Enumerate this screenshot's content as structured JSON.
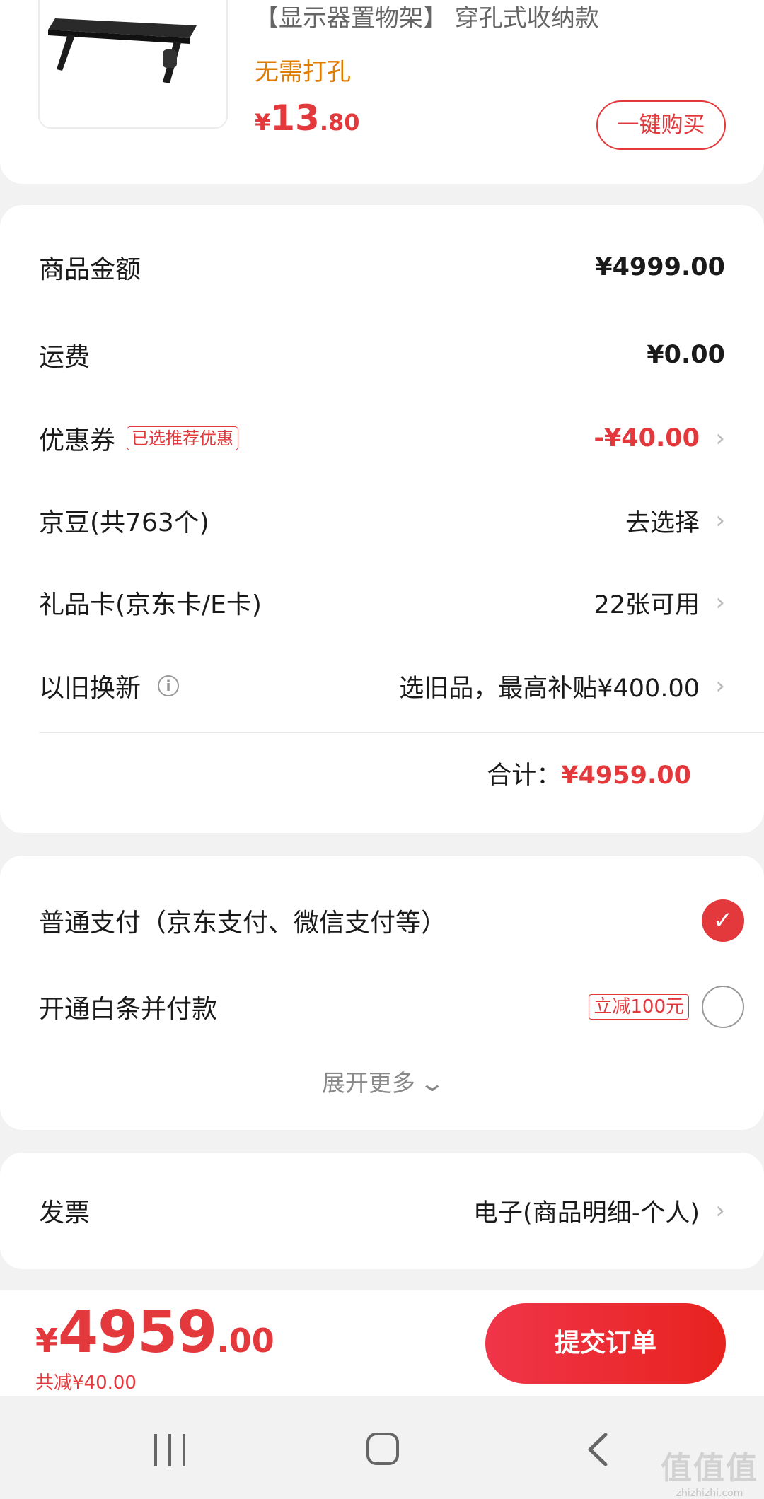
{
  "product": {
    "title": "【显示器置物架】 穿孔式收纳款",
    "tag": "无需打孔",
    "price_currency": "¥",
    "price_int": "13",
    "price_dec": ".80",
    "buy_label": "一键购买"
  },
  "summary": {
    "goods_amount": {
      "label": "商品金额",
      "value": "¥4999.00"
    },
    "shipping": {
      "label": "运费",
      "value": "¥0.00"
    },
    "coupon": {
      "label": "优惠券",
      "badge": "已选推荐优惠",
      "value": "-¥40.00"
    },
    "jingdou": {
      "label": "京豆(共763个)",
      "value": "去选择"
    },
    "giftcard": {
      "label": "礼品卡(京东卡/E卡)",
      "value": "22张可用"
    },
    "tradein": {
      "label": "以旧换新",
      "value": "选旧品，最高补贴¥400.00"
    },
    "total_label": "合计：",
    "total_value": "¥4959.00"
  },
  "payment": {
    "normal": {
      "label": "普通支付（京东支付、微信支付等）",
      "selected": true
    },
    "baitiao": {
      "label": "开通白条并付款",
      "tag": "立减100元",
      "selected": false
    },
    "expand_label": "展开更多"
  },
  "invoice": {
    "label": "发票",
    "value": "电子(商品明细-个人)"
  },
  "bottom": {
    "price_currency": "¥",
    "price_int": "4959",
    "price_dec": ".00",
    "saved": "共减¥40.00",
    "submit_label": "提交订单"
  },
  "watermark": {
    "logo": "值值值",
    "site": "zhizhizhi.com"
  },
  "colors": {
    "accent": "#e4393c",
    "tag_orange": "#e07b00",
    "background": "#f2f2f2"
  }
}
